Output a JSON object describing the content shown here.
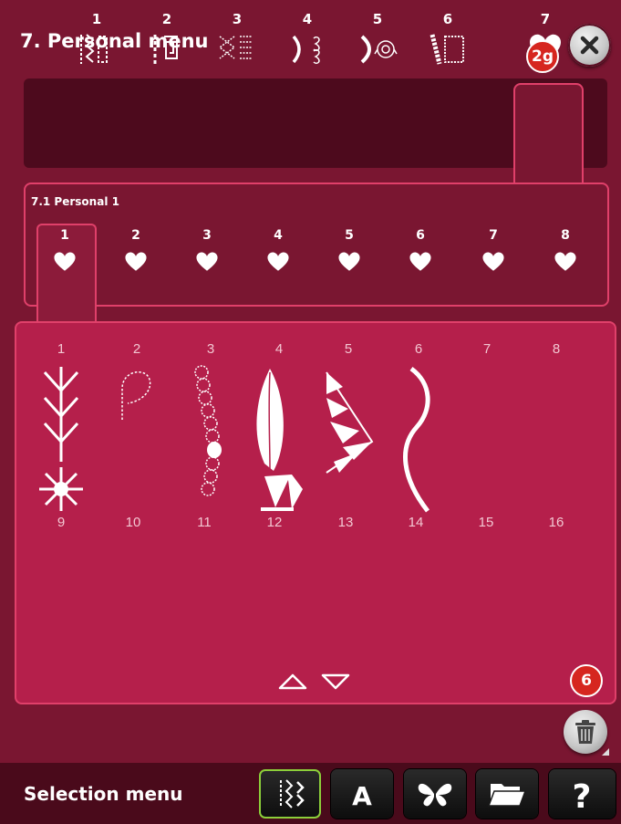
{
  "header": {
    "title": "7. Personal menu",
    "close_icon": "close-icon"
  },
  "callouts": {
    "tab_callout": "2g",
    "trash_callout": "6"
  },
  "categories": [
    {
      "number": "1",
      "icon": "utility-stitch-icon"
    },
    {
      "number": "2",
      "icon": "quilt-stitch-icon"
    },
    {
      "number": "3",
      "icon": "heirloom-stitch-icon"
    },
    {
      "number": "4",
      "icon": "decorative-stitch-icon"
    },
    {
      "number": "5",
      "icon": "floral-stitch-icon"
    },
    {
      "number": "6",
      "icon": "border-stitch-icon"
    },
    {
      "number": "7",
      "icon": "heart-icon",
      "selected": true
    }
  ],
  "subcategory": {
    "label": "7.1 Personal 1",
    "tabs": [
      {
        "number": "1",
        "icon": "heart-icon",
        "selected": true
      },
      {
        "number": "2",
        "icon": "heart-icon"
      },
      {
        "number": "3",
        "icon": "heart-icon"
      },
      {
        "number": "4",
        "icon": "heart-icon"
      },
      {
        "number": "5",
        "icon": "heart-icon"
      },
      {
        "number": "6",
        "icon": "heart-icon"
      },
      {
        "number": "7",
        "icon": "heart-icon"
      },
      {
        "number": "8",
        "icon": "heart-icon"
      }
    ]
  },
  "stitches": {
    "row1": [
      "1",
      "2",
      "3",
      "4",
      "5",
      "6",
      "7",
      "8"
    ],
    "row2": [
      "9",
      "10",
      "11",
      "12",
      "13",
      "14",
      "15",
      "16"
    ],
    "filled": [
      "1",
      "2",
      "3",
      "4",
      "5",
      "6"
    ]
  },
  "toolbar": {
    "label": "Selection menu",
    "buttons": [
      {
        "icon": "stitch-menu-icon",
        "selected": true
      },
      {
        "icon": "font-icon",
        "glyph": "A"
      },
      {
        "icon": "butterfly-icon"
      },
      {
        "icon": "folder-icon"
      },
      {
        "icon": "help-icon",
        "glyph": "?"
      }
    ]
  },
  "colors": {
    "background": "#7a1631",
    "panel": "#b51f4b",
    "highlight": "#e0406a",
    "callout": "#d6261f"
  }
}
